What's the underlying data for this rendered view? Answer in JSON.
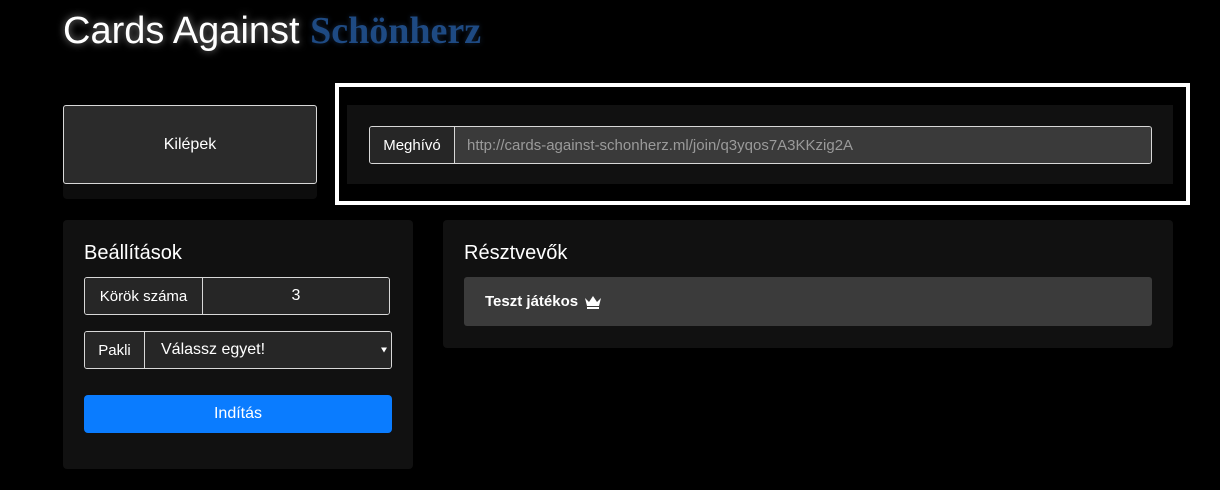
{
  "header": {
    "title_part1": "Cards Against",
    "title_part2": "Schönherz"
  },
  "exit": {
    "label": "Kilépek"
  },
  "invite": {
    "label": "Meghívó",
    "url": "http://cards-against-schonherz.ml/join/q3yqos7A3KKzig2A"
  },
  "settings": {
    "title": "Beállítások",
    "rounds_label": "Körök száma",
    "rounds_value": "3",
    "deck_label": "Pakli",
    "deck_selected": "Válassz egyet!",
    "start_label": "Indítás"
  },
  "participants": {
    "title": "Résztvevők",
    "players": [
      {
        "name": "Teszt játékos",
        "icon": "crown-icon"
      }
    ]
  },
  "colors": {
    "accent": "#0a7cff",
    "title_brand": "#1e4a83",
    "background": "#000000"
  }
}
